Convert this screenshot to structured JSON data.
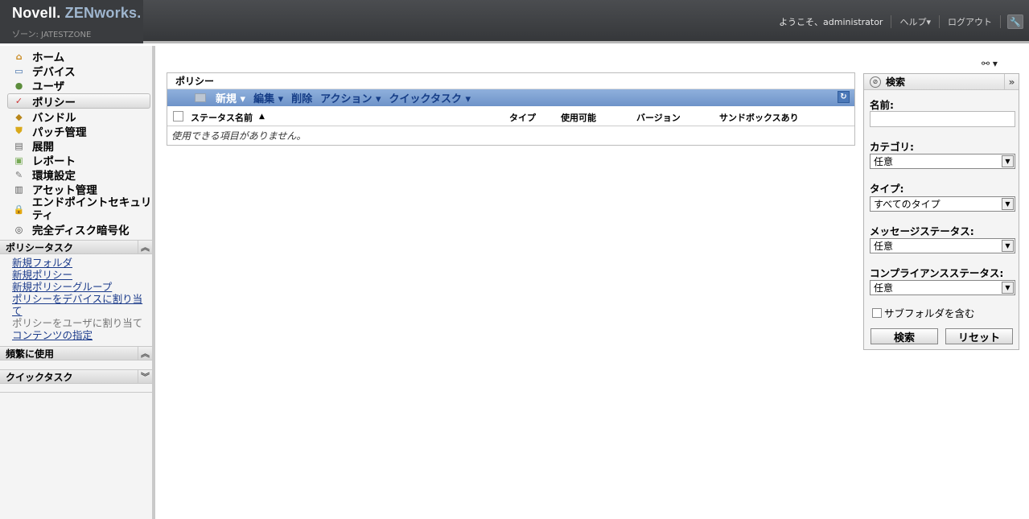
{
  "header": {
    "logo_brand": "Novell.",
    "logo_product": "ZENworks.",
    "zone": "ゾーン: JATESTZONE",
    "welcome": "ようこそ、administrator",
    "help": "ヘルプ▾",
    "logout": "ログアウト",
    "tool_icon": "wrench-icon"
  },
  "sidebar": {
    "nav": [
      {
        "label": "ホーム",
        "icon": "home-icon"
      },
      {
        "label": "デバイス",
        "icon": "monitor-icon"
      },
      {
        "label": "ユーザ",
        "icon": "users-icon"
      },
      {
        "label": "ポリシー",
        "icon": "policy-icon"
      },
      {
        "label": "バンドル",
        "icon": "bundle-icon"
      },
      {
        "label": "パッチ管理",
        "icon": "shield-icon"
      },
      {
        "label": "展開",
        "icon": "deploy-icon"
      },
      {
        "label": "レポート",
        "icon": "report-icon"
      },
      {
        "label": "環境設定",
        "icon": "wrench-icon"
      },
      {
        "label": "アセット管理",
        "icon": "asset-icon"
      },
      {
        "label": "エンドポイントセキュリティ",
        "icon": "lock-icon"
      },
      {
        "label": "完全ディスク暗号化",
        "icon": "disk-icon"
      }
    ],
    "policy_tasks": {
      "title": "ポリシータスク",
      "links": [
        "新規フォルダ",
        "新規ポリシー",
        "新規ポリシーグループ",
        "ポリシーをデバイスに割り当て",
        "ポリシーをユーザに割り当て",
        "コンテンツの指定"
      ]
    },
    "frequent": {
      "title": "頻繁に使用"
    },
    "quick_tasks": {
      "title": "クイックタスク"
    }
  },
  "main": {
    "panel_title": "ポリシー",
    "toolbar": {
      "new": "新規 ▾",
      "edit": "編集 ▾",
      "delete": "削除",
      "actions": "アクション ▾",
      "quick_tasks": "クイックタスク ▾"
    },
    "columns": {
      "status": "ステータス",
      "name": "名前",
      "sort": "▲",
      "type": "タイプ",
      "enabled": "使用可能",
      "version": "バージョン",
      "sandbox": "サンドボックスあり"
    },
    "empty_message": "使用できる項目がありません。"
  },
  "search": {
    "title": "検索",
    "name_label": "名前:",
    "name_value": "",
    "category_label": "カテゴリ:",
    "category_value": "任意",
    "type_label": "タイプ:",
    "type_value": "すべてのタイプ",
    "message_status_label": "メッセージステータス:",
    "message_status_value": "任意",
    "compliance_label": "コンプライアンスステータス:",
    "compliance_value": "任意",
    "include_subfolders": "サブフォルダを含む",
    "search_button": "検索",
    "reset_button": "リセット"
  }
}
